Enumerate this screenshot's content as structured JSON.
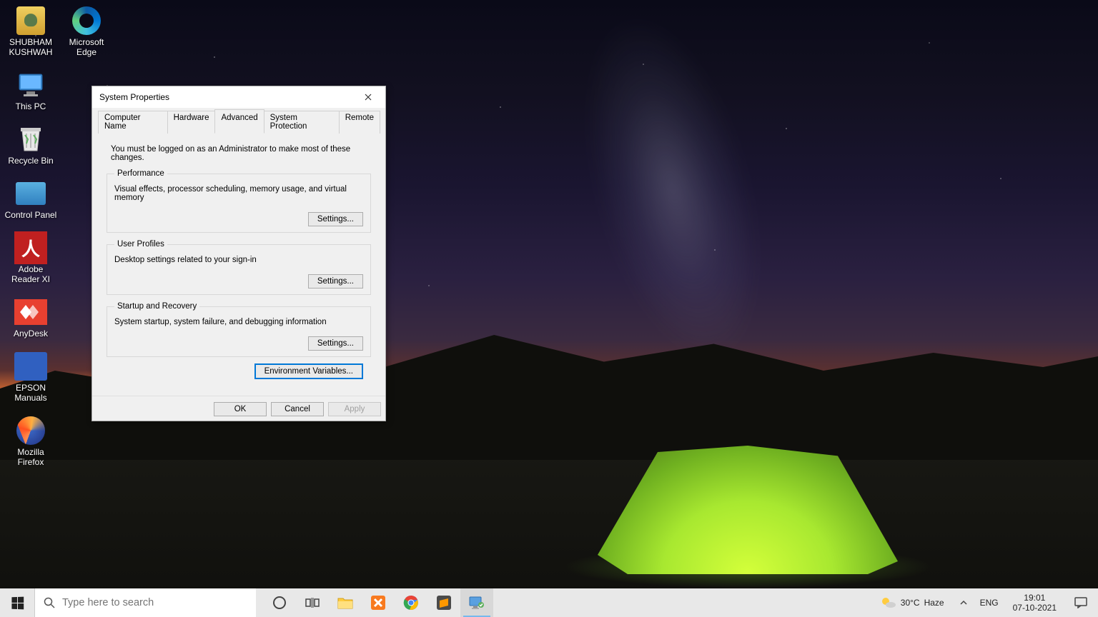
{
  "desktop_icons_col1": [
    {
      "key": "user-folder",
      "label": "SHUBHAM KUSHWAH"
    },
    {
      "key": "this-pc",
      "label": "This PC"
    },
    {
      "key": "recycle-bin",
      "label": "Recycle Bin"
    },
    {
      "key": "control-panel",
      "label": "Control Panel"
    },
    {
      "key": "adobe-reader",
      "label": "Adobe Reader XI"
    },
    {
      "key": "anydesk",
      "label": "AnyDesk"
    },
    {
      "key": "epson-manuals",
      "label": "EPSON Manuals"
    },
    {
      "key": "firefox",
      "label": "Mozilla Firefox"
    }
  ],
  "desktop_icons_col2": [
    {
      "key": "edge",
      "label": "Microsoft Edge"
    }
  ],
  "dialog": {
    "title": "System Properties",
    "tabs": [
      "Computer Name",
      "Hardware",
      "Advanced",
      "System Protection",
      "Remote"
    ],
    "active_tab": "Advanced",
    "intro": "You must be logged on as an Administrator to make most of these changes.",
    "sections": {
      "performance": {
        "legend": "Performance",
        "desc": "Visual effects, processor scheduling, memory usage, and virtual memory",
        "btn": "Settings..."
      },
      "user_profiles": {
        "legend": "User Profiles",
        "desc": "Desktop settings related to your sign-in",
        "btn": "Settings..."
      },
      "startup": {
        "legend": "Startup and Recovery",
        "desc": "System startup, system failure, and debugging information",
        "btn": "Settings..."
      }
    },
    "env_btn": "Environment Variables...",
    "buttons": {
      "ok": "OK",
      "cancel": "Cancel",
      "apply": "Apply"
    }
  },
  "taskbar": {
    "search_placeholder": "Type here to search",
    "weather_temp": "30°C",
    "weather_cond": "Haze",
    "lang": "ENG",
    "time": "19:01",
    "date": "07-10-2021"
  }
}
